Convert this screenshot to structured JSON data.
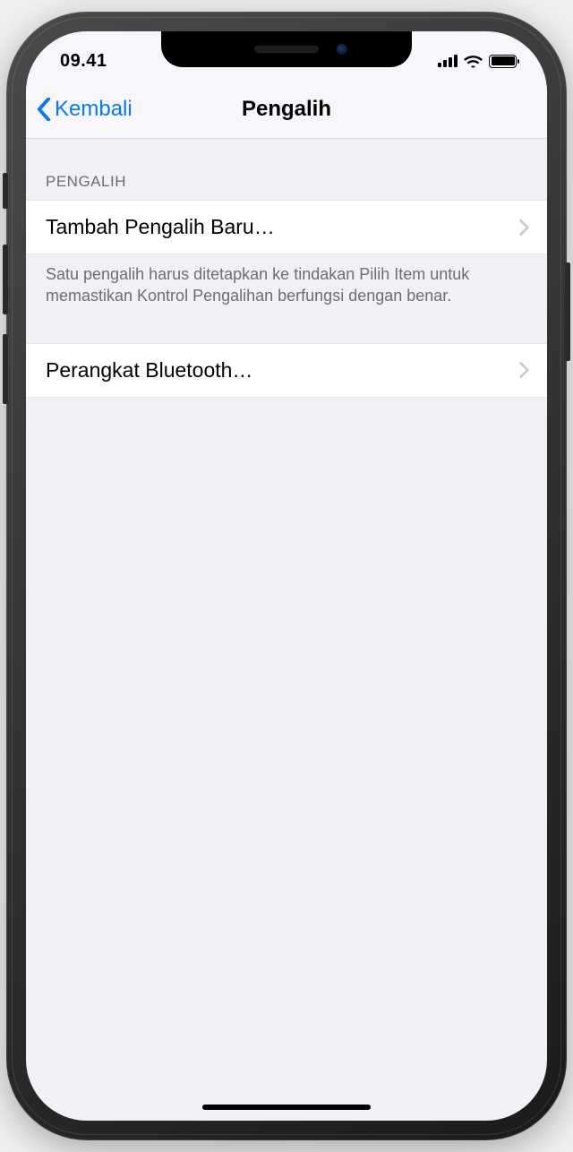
{
  "status": {
    "time": "09.41"
  },
  "nav": {
    "back_label": "Kembali",
    "title": "Pengalih"
  },
  "section": {
    "header": "PENGALIH",
    "add_switch_label": "Tambah Pengalih Baru…",
    "footer_text": "Satu pengalih harus ditetapkan ke tindakan Pilih Item untuk memastikan Kontrol Pengalihan berfungsi dengan benar.",
    "bluetooth_label": "Perangkat Bluetooth…"
  }
}
